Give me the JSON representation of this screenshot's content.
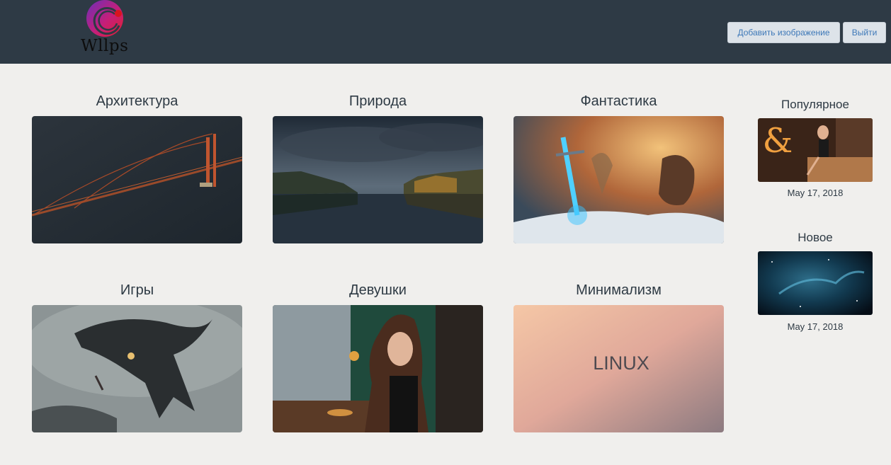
{
  "header": {
    "logo_text": "Wllps",
    "add_image_label": "Добавить изображение",
    "logout_label": "Выйти"
  },
  "categories": [
    {
      "title": "Архитектура",
      "image": "bridge-photo"
    },
    {
      "title": "Природа",
      "image": "lake-photo"
    },
    {
      "title": "Фантастика",
      "image": "sword-fantasy-art"
    },
    {
      "title": "Игры",
      "image": "dragon-game-art"
    },
    {
      "title": "Девушки",
      "image": "girl-cafe-photo"
    },
    {
      "title": "Минимализм",
      "image": "linux-minimal-wallpaper",
      "image_text": "LINUX"
    }
  ],
  "sidebar": {
    "popular": {
      "title": "Популярное",
      "date": "May 17, 2018",
      "image": "woman-on-sofa-photo"
    },
    "new": {
      "title": "Новое",
      "date": "May 17, 2018",
      "image": "space-nebula-art"
    }
  },
  "colors": {
    "header_bg": "#2e3a45",
    "page_bg": "#f0efed",
    "button_bg": "#dde3e9",
    "button_text": "#3d78b8"
  }
}
